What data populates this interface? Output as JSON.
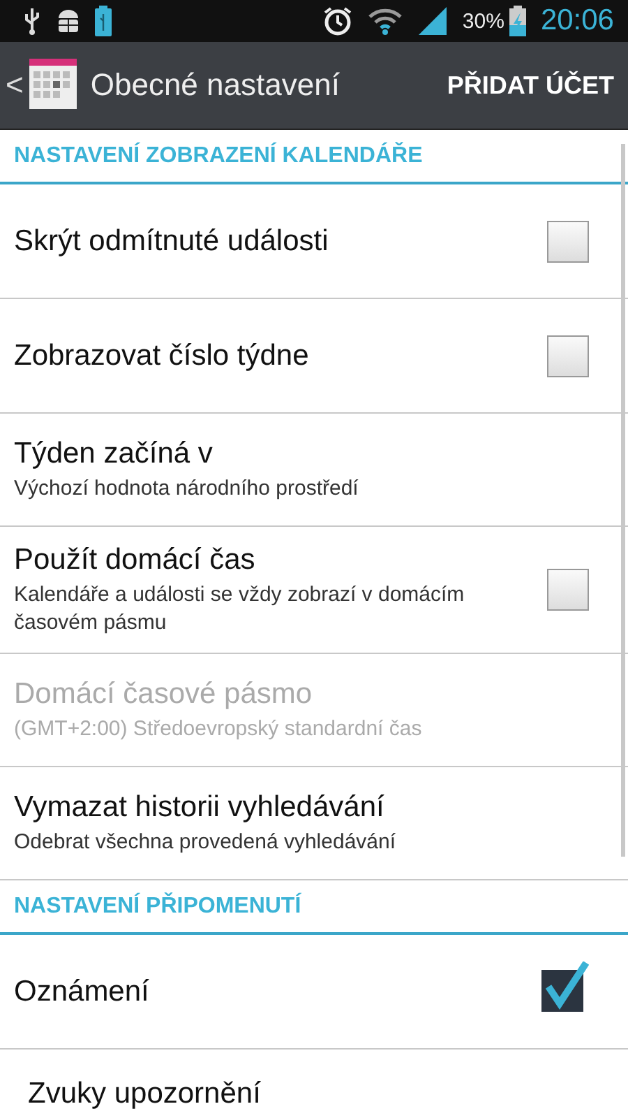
{
  "status_bar": {
    "battery_percent": "30%",
    "time": "20:06"
  },
  "action_bar": {
    "back": "<",
    "title": "Obecné nastavení",
    "action": "PŘIDAT ÚČET"
  },
  "sections": [
    {
      "header": "NASTAVENÍ ZOBRAZENÍ KALENDÁŘE",
      "items": [
        {
          "kind": "checkbox",
          "title": "Skrýt odmítnuté události",
          "checked": false,
          "disabled": false
        },
        {
          "kind": "checkbox",
          "title": "Zobrazovat číslo týdne",
          "checked": false,
          "disabled": false
        },
        {
          "kind": "text",
          "title": "Týden začíná v",
          "subtitle": "Výchozí hodnota národního prostředí",
          "disabled": false
        },
        {
          "kind": "checkbox",
          "title": "Použít domácí čas",
          "subtitle": "Kalendáře a události se vždy zobrazí v domácím časovém pásmu",
          "checked": false,
          "disabled": false
        },
        {
          "kind": "text",
          "title": "Domácí časové pásmo",
          "subtitle": "(GMT+2:00) Středoevropský standardní čas",
          "disabled": true
        },
        {
          "kind": "text",
          "title": "Vymazat historii vyhledávání",
          "subtitle": "Odebrat všechna provedená vyhledávání",
          "disabled": false
        }
      ]
    },
    {
      "header": "NASTAVENÍ PŘIPOMENUTÍ",
      "items": [
        {
          "kind": "checkbox",
          "title": "Oznámení",
          "checked": true,
          "disabled": false
        },
        {
          "kind": "text",
          "title": "Zvuky upozornění",
          "disabled": false
        }
      ]
    }
  ]
}
